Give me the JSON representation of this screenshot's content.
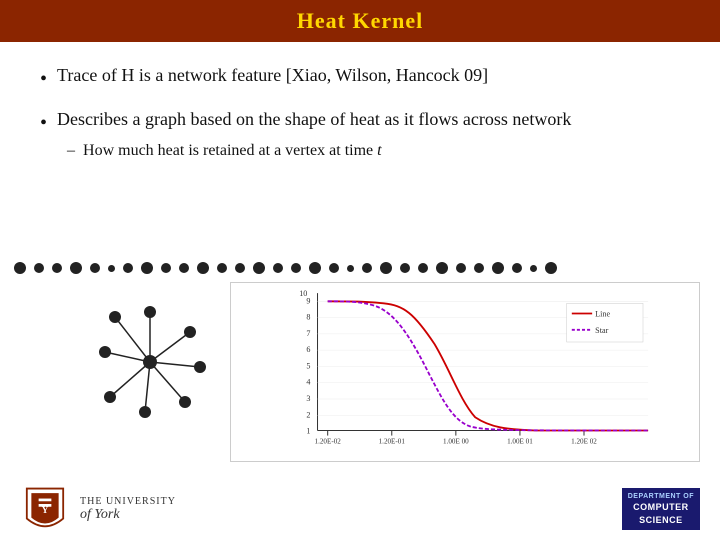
{
  "slide": {
    "title": "Heat Kernel",
    "bullets": [
      {
        "text": "Trace of H is a network feature [Xiao, Wilson, Hancock 09]"
      },
      {
        "text": "Describes a graph based on the shape of heat as it flows across network",
        "sub": [
          "How much heat is retained at a vertex at time t"
        ]
      }
    ],
    "footer": {
      "university_line1": "THE UNIVERSITY",
      "university_of": "of York",
      "cs_label": "COMPUTER\nSCIENCE"
    },
    "chart": {
      "legend": [
        {
          "label": "Line",
          "color": "#cc0000"
        },
        {
          "label": "Star",
          "color": "#9900cc"
        }
      ],
      "x_labels": [
        "1.20E-02",
        "1.20E-01",
        "1.00E 00",
        "1.00E 01",
        "1.20E 02"
      ],
      "y_labels": [
        "1",
        "2",
        "3",
        "4",
        "5",
        "6",
        "7",
        "8",
        "9",
        "10"
      ]
    }
  }
}
